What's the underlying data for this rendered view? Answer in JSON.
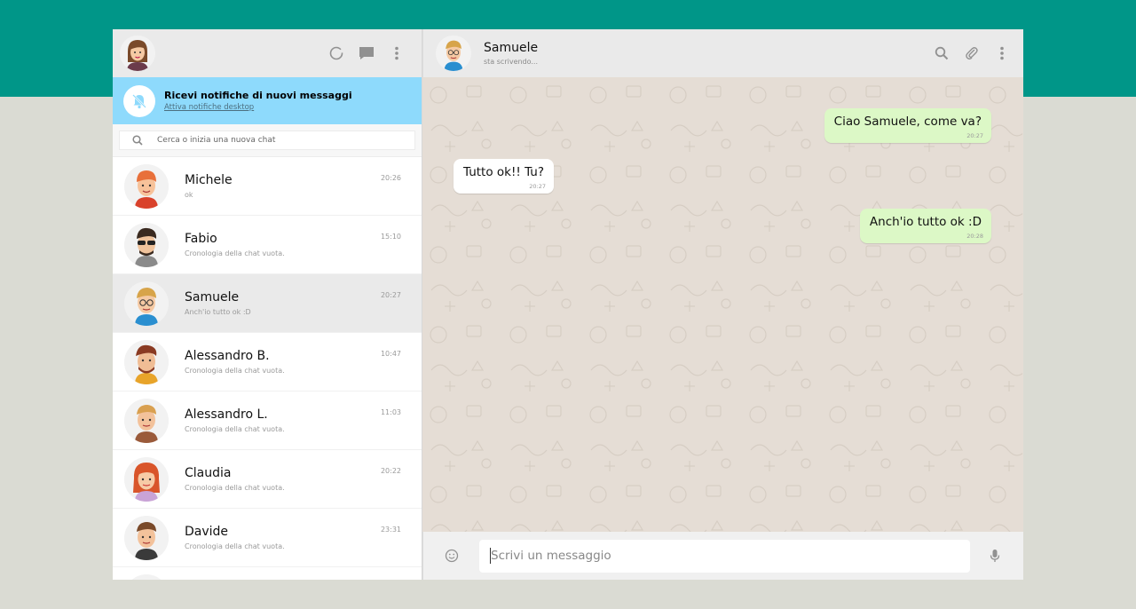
{
  "sidebar": {
    "notification": {
      "title": "Ricevi notifiche di nuovi messaggi",
      "link": "Attiva notifiche desktop"
    },
    "search": {
      "placeholder": "Cerca o inizia una nuova chat"
    },
    "icons": [
      "status-icon",
      "new-chat-icon",
      "menu-icon"
    ],
    "chats": [
      {
        "name": "Michele",
        "last": "ok",
        "time": "20:26",
        "active": false
      },
      {
        "name": "Fabio",
        "last": "Cronologia della chat vuota.",
        "time": "15:10",
        "active": false
      },
      {
        "name": "Samuele",
        "last": "Anch'io tutto ok :D",
        "time": "20:27",
        "active": true
      },
      {
        "name": "Alessandro B.",
        "last": "Cronologia della chat vuota.",
        "time": "10:47",
        "active": false
      },
      {
        "name": "Alessandro L.",
        "last": "Cronologia della chat vuota.",
        "time": "11:03",
        "active": false
      },
      {
        "name": "Claudia",
        "last": "Cronologia della chat vuota.",
        "time": "20:22",
        "active": false
      },
      {
        "name": "Davide",
        "last": "Cronologia della chat vuota.",
        "time": "23:31",
        "active": false
      }
    ]
  },
  "conversation": {
    "name": "Samuele",
    "status": "sta scrivendo...",
    "icons": [
      "search-icon",
      "attach-icon",
      "menu-icon"
    ],
    "messages": [
      {
        "text": "Ciao Samuele, come va?",
        "time": "20:27",
        "direction": "out"
      },
      {
        "text": "Tutto ok!! Tu?",
        "time": "20:27",
        "direction": "in"
      },
      {
        "text": "Anch'io tutto ok :D",
        "time": "20:28",
        "direction": "out"
      }
    ],
    "composer": {
      "placeholder": "Scrivi un messaggio"
    }
  },
  "colors": {
    "brand": "#009688",
    "notification": "#8edafc",
    "outgoing": "#dcf8c6",
    "incoming": "#ffffff",
    "chat_bg": "#e5ddd5"
  }
}
